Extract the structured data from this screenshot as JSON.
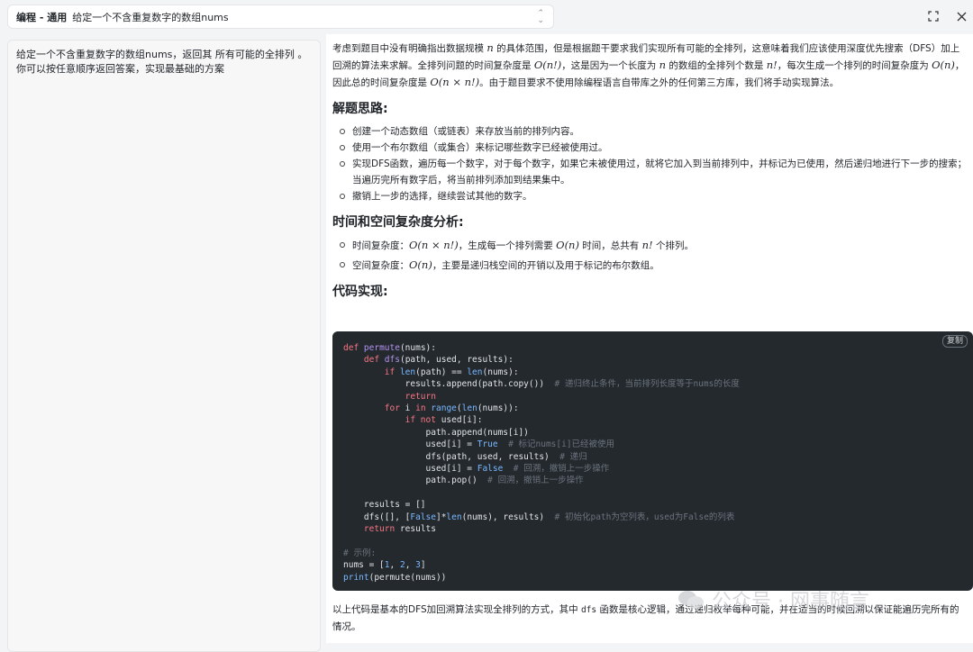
{
  "header": {
    "category": "编程 - 通用",
    "title": "给定一个不含重复数字的数组nums"
  },
  "question": {
    "text": "给定一个不含重复数字的数组nums，返回其 所有可能的全排列 。你可以按任意顺序返回答案，实现最基础的方案"
  },
  "answer": {
    "intro_a": "考虑到题目中没有明确指出数据规模",
    "intro_b": "的具体范围，但是根据题干要求我们实现所有可能的全排列，这意味着我们应该使用深度优先搜索（DFS）加上回溯的算法来求解。全排列问题的时间复杂度是",
    "intro_c": "，这是因为一个长度为",
    "intro_d": "的数组的全排列个数是",
    "intro_e": "，每次生成一个排列的时间复杂度为",
    "intro_f": "，因此总的时间复杂度是",
    "intro_g": "。由于题目要求不使用除编程语言自带库之外的任何第三方库，我们将手动实现算法。",
    "math_n": "n",
    "math_on_fact": "O(n!)",
    "math_n_fact": "n!",
    "math_on": "O(n)",
    "math_on_x": "O(n × n!)",
    "section1": "解题思路:",
    "steps": [
      "创建一个动态数组（或链表）来存放当前的排列内容。",
      "使用一个布尔数组（或集合）来标记哪些数字已经被使用过。",
      "实现DFS函数，遍历每一个数字，对于每个数字，如果它未被使用过，就将它加入到当前排列中，并标记为已使用，然后递归地进行下一步的搜索；当遍历完所有数字后，将当前排列添加到结果集中。",
      "撤销上一步的选择，继续尝试其他的数字。"
    ],
    "section2": "时间和空间复杂度分析:",
    "time_label": "时间复杂度：",
    "time_text_a": "，生成每一个排列需要",
    "time_text_b": "时间，总共有",
    "time_text_c": "个排列。",
    "space_label": "空间复杂度：",
    "space_text": "，主要是递归栈空间的开销以及用于标记的布尔数组。",
    "section3": "代码实现:",
    "copy_label": "复制",
    "footer_a": "以上代码是基本的DFS加回溯算法实现全排列的方式，其中",
    "footer_code": "dfs",
    "footer_b": "函数是核心逻辑，通过递归枚举每种可能，并在适当的时候回溯以保证能遍历完所有的情况。",
    "watermark": "公众号 · 网事随言"
  }
}
